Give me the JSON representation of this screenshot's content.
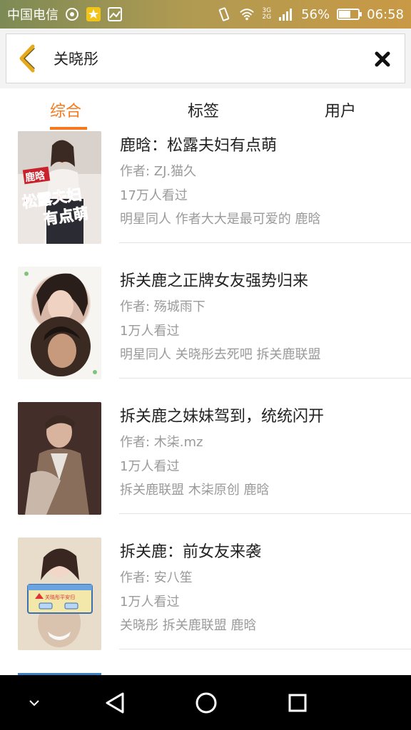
{
  "status_bar": {
    "carrier": "中国电信",
    "network_top": "3G",
    "network_bottom": "2G",
    "battery_percent": "56%",
    "battery_level": 0.56,
    "time": "06:58"
  },
  "search": {
    "query": "关晓彤"
  },
  "tabs": [
    {
      "label": "综合",
      "active": true
    },
    {
      "label": "标签",
      "active": false
    },
    {
      "label": "用户",
      "active": false
    }
  ],
  "results": [
    {
      "title": "鹿晗：松露夫妇有点萌",
      "author": "作者: ZJ.猫久",
      "views": "17万人看过",
      "tags": "明星同人 作者大大是最可爱的 鹿晗",
      "cover_text_top": "鹿晗",
      "cover_text_main": "松露夫妇",
      "cover_text_sub": "有点萌"
    },
    {
      "title": "拆关鹿之正牌女友强势归来",
      "author": "作者: 殇城雨下",
      "views": "1万人看过",
      "tags": "明星同人 关晓彤去死吧 拆关鹿联盟"
    },
    {
      "title": "拆关鹿之妹妹驾到，统统闪开",
      "author": "作者: 木柒.mz",
      "views": "1万人看过",
      "tags": "拆关鹿联盟 木柒原创 鹿晗"
    },
    {
      "title": "拆关鹿：前女友来袭",
      "author": "作者: 安八笙",
      "views": "1万人看过",
      "tags": "关晓彤 拆关鹿联盟 鹿晗",
      "cover_dialog_text": "关晓彤平安归"
    }
  ],
  "colors": {
    "accent": "#f47a20",
    "status_bar": "#b09a52",
    "back_arrow": "#e8a81c",
    "nav_bar": "#000000"
  }
}
